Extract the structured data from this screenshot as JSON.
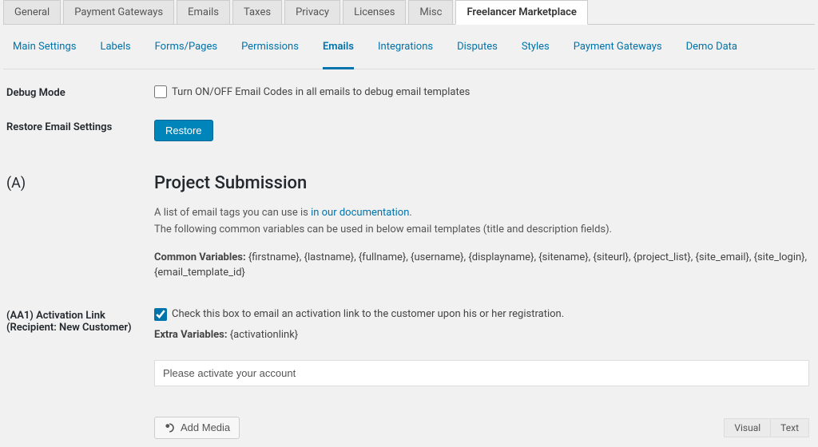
{
  "topTabs": {
    "general": "General",
    "paymentGateways": "Payment Gateways",
    "emails": "Emails",
    "taxes": "Taxes",
    "privacy": "Privacy",
    "licenses": "Licenses",
    "misc": "Misc",
    "freelancerMarketplace": "Freelancer Marketplace"
  },
  "subTabs": {
    "mainSettings": "Main Settings",
    "labels": "Labels",
    "formsPages": "Forms/Pages",
    "permissions": "Permissions",
    "emails": "Emails",
    "integrations": "Integrations",
    "disputes": "Disputes",
    "styles": "Styles",
    "paymentGateways": "Payment Gateways",
    "demoData": "Demo Data"
  },
  "debugMode": {
    "label": "Debug Mode",
    "checkbox_label": "Turn ON/OFF Email Codes in all emails to debug email templates",
    "checked": false
  },
  "restoreEmail": {
    "label": "Restore Email Settings",
    "button": "Restore"
  },
  "sectionA": {
    "label": "(A)",
    "title": "Project Submission",
    "desc_prefix": "A list of email tags you can use is ",
    "desc_link": "in our documentation",
    "desc_suffix": ".",
    "desc_line2": "The following common variables can be used in below email templates (title and description fields).",
    "common_vars_label": "Common Variables:",
    "common_vars": "{firstname}, {lastname}, {fullname}, {username}, {displayname}, {sitename}, {siteurl}, {project_list}, {site_email}, {site_login}, {email_template_id}"
  },
  "aa1": {
    "label_line1": "(AA1) Activation Link",
    "label_line2": "(Recipient: New Customer)",
    "checkbox_label": "Check this box to email an activation link to the customer upon his or her registration.",
    "checked": true,
    "extra_vars_label": "Extra Variables:",
    "extra_vars": "{activationlink}",
    "input_value": "Please activate your account"
  },
  "editor": {
    "addMedia": "Add Media",
    "visual": "Visual",
    "text": "Text"
  }
}
